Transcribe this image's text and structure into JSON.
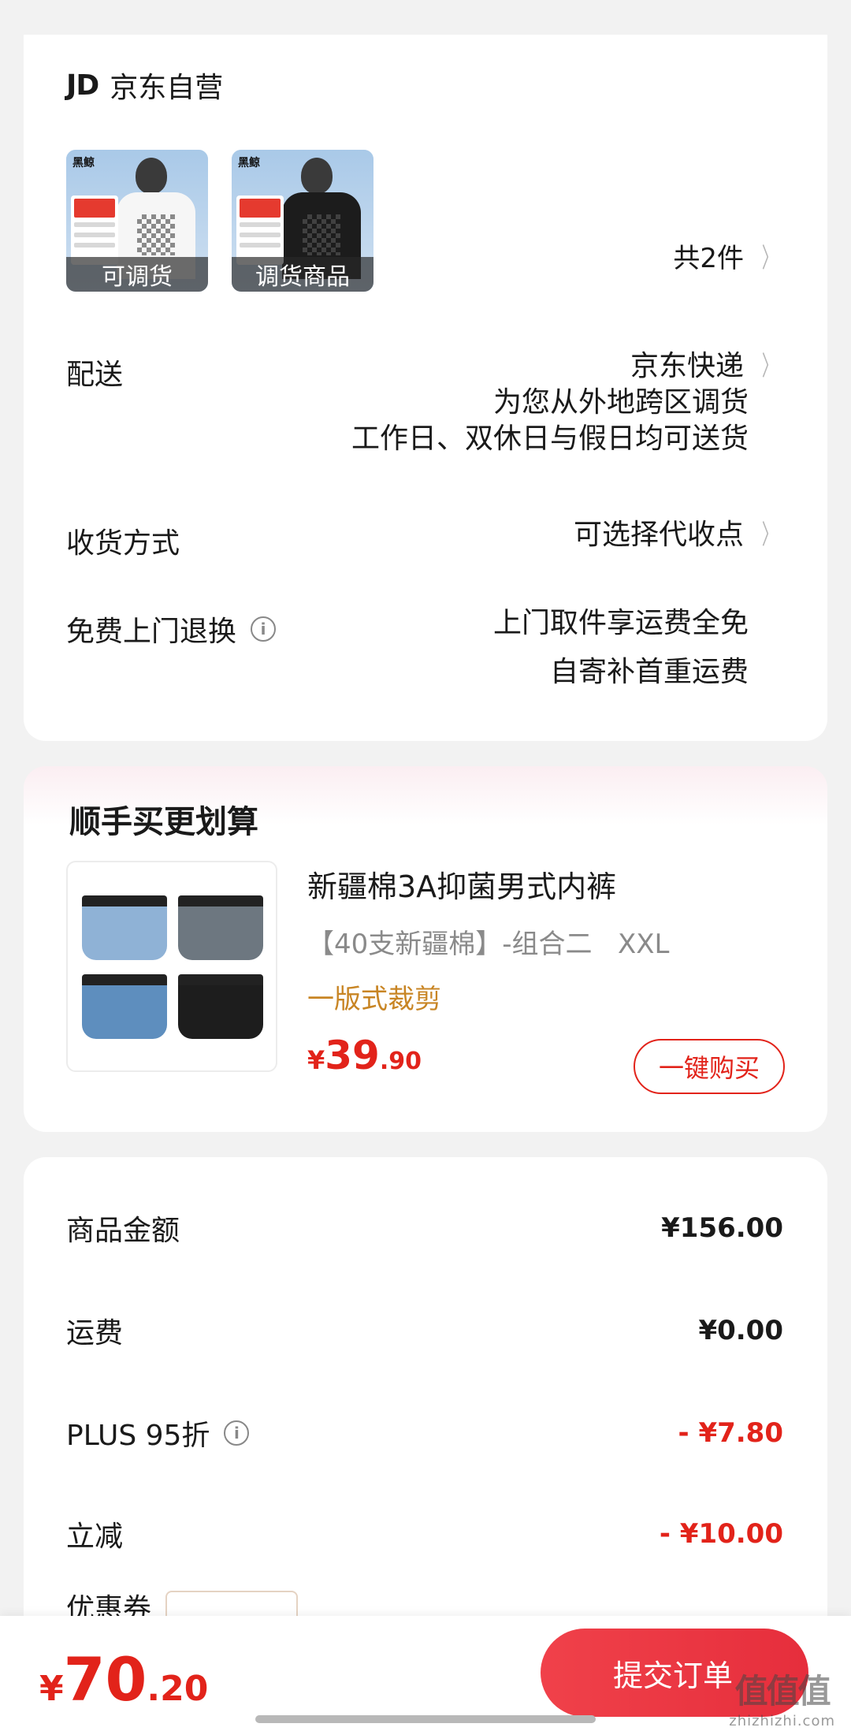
{
  "store": {
    "logo": "JD",
    "name": "京东自营",
    "thumbs": [
      {
        "tag": "可调货",
        "shirt_color": "#f6f6f6"
      },
      {
        "tag": "调货商品",
        "shirt_color": "#1c1c1c"
      }
    ],
    "thumb_brand": "黑鲸",
    "item_count": "共2件"
  },
  "delivery": {
    "label": "配送",
    "carrier": "京东快递",
    "note1": "为您从外地跨区调货",
    "note2": "工作日、双休日与假日均可送货"
  },
  "receive": {
    "label": "收货方式",
    "value": "可选择代收点"
  },
  "return": {
    "label": "免费上门退换",
    "line1": "上门取件享运费全免",
    "line2": "自寄补首重运费"
  },
  "upsell": {
    "title": "顺手买更划算",
    "product_name": "新疆棉3A抑菌男式内裤",
    "spec": "【40支新疆棉】-组合二   XXL",
    "feature": "一版式裁剪",
    "price_currency": "¥",
    "price_int": "39",
    "price_dec": ".90",
    "buy_label": "一键购买",
    "brief_colors": [
      "#8fb2d6",
      "#6d7780",
      "#5e8ebe",
      "#1d1d1d"
    ]
  },
  "summary": {
    "rows": [
      {
        "label": "商品金额",
        "value": "¥156.00"
      },
      {
        "label": "运费",
        "value": "¥0.00"
      },
      {
        "label": "PLUS 95折",
        "value": "- ¥7.80"
      },
      {
        "label": "立减",
        "value": "- ¥10.00"
      }
    ],
    "partial_label": "优惠券"
  },
  "bottom": {
    "currency": "¥",
    "total_int": "70",
    "total_dec": ".20",
    "submit_label": "提交订单",
    "watermark_logo": "值值值",
    "watermark_url": "zhizhizhi.com"
  },
  "colors": {
    "accent_red": "#e2231a",
    "feature_orange": "#c88524"
  }
}
